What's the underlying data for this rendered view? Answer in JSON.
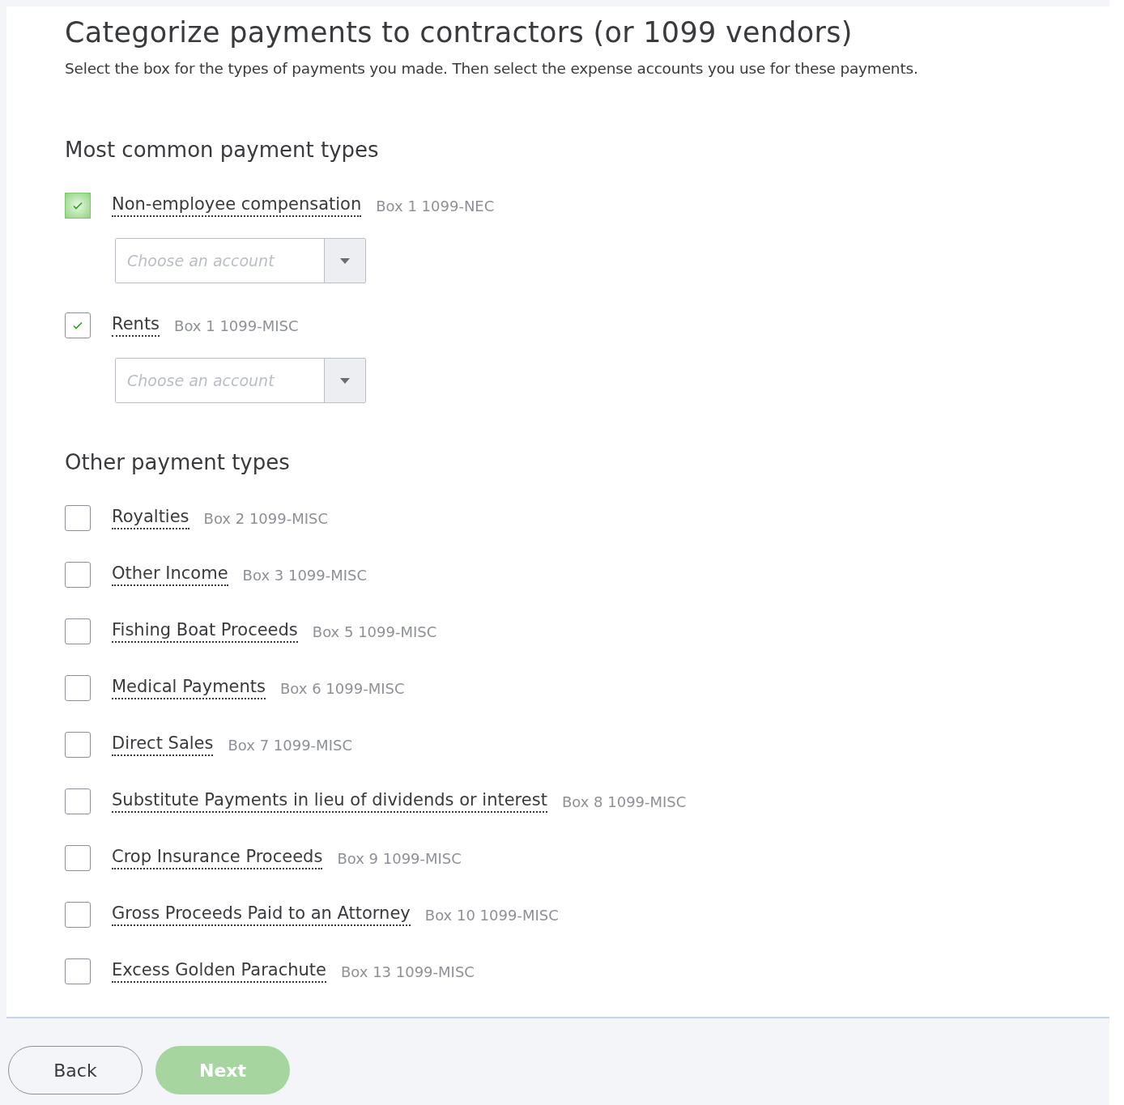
{
  "title": "Categorize payments to contractors (or 1099 vendors)",
  "subtitle": "Select the box for the types of payments you made. Then select the expense accounts you use for these payments.",
  "sections": [
    {
      "heading": "Most common payment types",
      "items": [
        {
          "label": "Non-employee compensation",
          "box": "Box 1 1099-NEC",
          "checked": true,
          "highlighted": true,
          "account": {
            "placeholder": "Choose an account"
          }
        },
        {
          "label": "Rents",
          "box": "Box 1 1099-MISC",
          "checked": true,
          "highlighted": false,
          "account": {
            "placeholder": "Choose an account"
          }
        }
      ]
    },
    {
      "heading": "Other payment types",
      "items": [
        {
          "label": "Royalties",
          "box": "Box 2 1099-MISC",
          "checked": false,
          "highlighted": false
        },
        {
          "label": "Other Income",
          "box": "Box 3 1099-MISC",
          "checked": false,
          "highlighted": false
        },
        {
          "label": "Fishing Boat Proceeds",
          "box": "Box 5 1099-MISC",
          "checked": false,
          "highlighted": false
        },
        {
          "label": "Medical Payments",
          "box": "Box 6 1099-MISC",
          "checked": false,
          "highlighted": false
        },
        {
          "label": "Direct Sales",
          "box": "Box 7 1099-MISC",
          "checked": false,
          "highlighted": false
        },
        {
          "label": "Substitute Payments in lieu of dividends or interest",
          "box": "Box 8 1099-MISC",
          "checked": false,
          "highlighted": false
        },
        {
          "label": "Crop Insurance Proceeds",
          "box": "Box 9 1099-MISC",
          "checked": false,
          "highlighted": false
        },
        {
          "label": "Gross Proceeds Paid to an Attorney",
          "box": "Box 10 1099-MISC",
          "checked": false,
          "highlighted": false
        },
        {
          "label": "Excess Golden Parachute",
          "box": "Box 13 1099-MISC",
          "checked": false,
          "highlighted": false
        }
      ]
    }
  ],
  "buttons": [
    {
      "label": "Back",
      "kind": "secondary",
      "disabled": false
    },
    {
      "label": "Next",
      "kind": "primary",
      "disabled": true
    }
  ]
}
